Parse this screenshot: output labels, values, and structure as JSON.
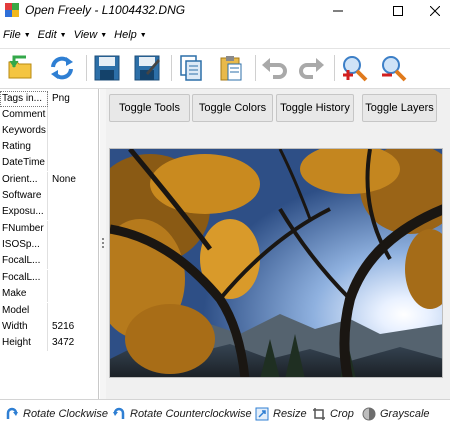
{
  "window": {
    "app_name": "Open Freely",
    "file_name": "L1004432.DNG",
    "title": "Open Freely - L1004432.DNG"
  },
  "menu": [
    {
      "label": "File"
    },
    {
      "label": "Edit"
    },
    {
      "label": "View"
    },
    {
      "label": "Help"
    }
  ],
  "toolbar": {
    "icons": [
      "open-folder-icon",
      "refresh-icon",
      "save-icon",
      "save-as-icon",
      "copy-icon",
      "paste-icon",
      "undo-icon",
      "redo-icon",
      "zoom-in-icon",
      "zoom-out-icon"
    ]
  },
  "tags": [
    {
      "key": "Tags in...",
      "value": "Png"
    },
    {
      "key": "Comment",
      "value": ""
    },
    {
      "key": "Keywords",
      "value": ""
    },
    {
      "key": "Rating",
      "value": ""
    },
    {
      "key": "DateTime",
      "value": ""
    },
    {
      "key": "Orient...",
      "value": "None"
    },
    {
      "key": "Software",
      "value": ""
    },
    {
      "key": "Exposu...",
      "value": ""
    },
    {
      "key": "FNumber",
      "value": ""
    },
    {
      "key": "ISOSp...",
      "value": ""
    },
    {
      "key": "FocalL...",
      "value": ""
    },
    {
      "key": "FocalL...",
      "value": ""
    },
    {
      "key": "Make",
      "value": ""
    },
    {
      "key": "Model",
      "value": ""
    },
    {
      "key": "Width",
      "value": "5216"
    },
    {
      "key": "Height",
      "value": "3472"
    }
  ],
  "toggles": {
    "tools": "Toggle Tools",
    "colors": "Toggle Colors",
    "history": "Toggle History",
    "layers": "Toggle Layers"
  },
  "actions": {
    "rotate_cw": "Rotate Clockwise",
    "rotate_ccw": "Rotate Counterclockwise",
    "resize": "Resize",
    "crop": "Crop",
    "grayscale": "Grayscale"
  },
  "colors": {
    "accent_blue": "#2f7fd3",
    "title_text": "#000000"
  }
}
